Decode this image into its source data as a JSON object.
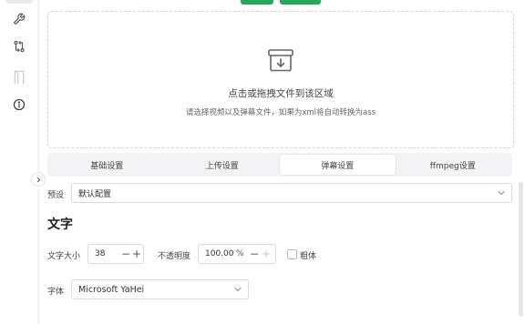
{
  "upload": {
    "title": "点击或拖拽文件到该区域",
    "subtitle": "请选择视频以及弹幕文件，如果为xml将自动转换为ass"
  },
  "tabs": [
    {
      "label": "基础设置",
      "active": false
    },
    {
      "label": "上传设置",
      "active": false
    },
    {
      "label": "弹幕设置",
      "active": true
    },
    {
      "label": "ffmpeg设置",
      "active": false
    }
  ],
  "preset": {
    "label": "预设",
    "value": "默认配置"
  },
  "section": {
    "title": "文字"
  },
  "text_size": {
    "label": "文字大小",
    "value": "38",
    "minus": "−",
    "plus": "+"
  },
  "opacity": {
    "label": "不透明度",
    "value": "100.00",
    "unit": "%",
    "minus": "−",
    "plus": "+"
  },
  "bold": {
    "label": "粗体",
    "checked": false
  },
  "font": {
    "label": "字体",
    "value": "Microsoft YaHei"
  },
  "colors": {
    "accent": "#26a65b",
    "border": "#dcdcdc",
    "tab_bg": "#f3f3f5"
  },
  "icons": [
    "wrench-icon",
    "git-compare-icon",
    "door-icon",
    "info-icon",
    "chevron-right-icon",
    "file-import-icon",
    "chevron-down-icon"
  ]
}
